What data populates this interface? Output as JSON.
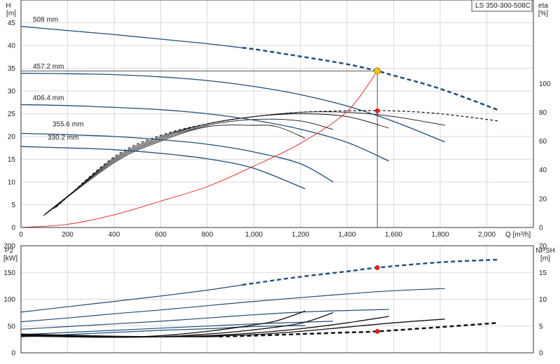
{
  "model": "LS 350-300-508C",
  "colors": {
    "blue": "#1f4e79",
    "red": "#e02020",
    "black": "#111111",
    "grid": "#d9d9d9",
    "op_point": "#f5c518"
  },
  "chart_data": [
    {
      "type": "line",
      "panel": "head_efficiency",
      "y_left_label": [
        "H",
        "[m]"
      ],
      "y_right_label": [
        "eta",
        "[%]"
      ],
      "x_label": "Q [m³/h]",
      "xlim": [
        0,
        2200
      ],
      "ylim": [
        0,
        50
      ],
      "y_right_lim": [
        0,
        158
      ],
      "x_ticks": [
        0,
        200,
        400,
        600,
        800,
        1000,
        1200,
        1400,
        1600,
        1800,
        2000
      ],
      "x_tick_labels": [
        "0",
        "200",
        "400",
        "600",
        "800",
        "1,000",
        "1,200",
        "1,400",
        "1,600",
        "1,800",
        "2,000"
      ],
      "y_ticks": [
        0,
        5,
        10,
        15,
        20,
        25,
        30,
        35,
        40,
        45
      ],
      "y_right_ticks": [
        0,
        20,
        40,
        60,
        80,
        100
      ],
      "head_curves": [
        {
          "name": "508 mm",
          "points": [
            [
              0,
              44.2
            ],
            [
              200,
              43.3
            ],
            [
              400,
              42.4
            ],
            [
              600,
              41.4
            ],
            [
              800,
              40.4
            ],
            [
              1000,
              39.2
            ],
            [
              1200,
              37.6
            ],
            [
              1400,
              35.9
            ],
            [
              1530,
              34.4
            ],
            [
              1600,
              33.4
            ],
            [
              1800,
              30.5
            ],
            [
              2050,
              25.8
            ]
          ],
          "dashed_from": 950
        },
        {
          "name": "457.2 mm",
          "points": [
            [
              0,
              33.9
            ],
            [
              200,
              33.8
            ],
            [
              400,
              33.6
            ],
            [
              600,
              33.1
            ],
            [
              800,
              32.3
            ],
            [
              1000,
              31.0
            ],
            [
              1200,
              29.2
            ],
            [
              1400,
              26.7
            ],
            [
              1600,
              23.3
            ],
            [
              1820,
              18.8
            ]
          ]
        },
        {
          "name": "406.4 mm",
          "points": [
            [
              0,
              27.0
            ],
            [
              200,
              26.8
            ],
            [
              400,
              26.4
            ],
            [
              600,
              25.9
            ],
            [
              800,
              25.0
            ],
            [
              1000,
              23.6
            ],
            [
              1200,
              21.6
            ],
            [
              1400,
              18.7
            ],
            [
              1580,
              14.6
            ]
          ]
        },
        {
          "name": "355.6 mm",
          "points": [
            [
              0,
              20.7
            ],
            [
              200,
              20.4
            ],
            [
              400,
              20.0
            ],
            [
              600,
              19.3
            ],
            [
              800,
              18.3
            ],
            [
              1000,
              16.6
            ],
            [
              1200,
              14.0
            ],
            [
              1340,
              10.0
            ]
          ]
        },
        {
          "name": "330.2 mm",
          "points": [
            [
              0,
              17.8
            ],
            [
              200,
              17.5
            ],
            [
              400,
              17.1
            ],
            [
              600,
              16.3
            ],
            [
              800,
              15.1
            ],
            [
              1000,
              13.0
            ],
            [
              1220,
              8.5
            ]
          ]
        }
      ],
      "system_curve": [
        [
          0,
          0
        ],
        [
          200,
          0.7
        ],
        [
          400,
          2.8
        ],
        [
          600,
          5.8
        ],
        [
          800,
          9.0
        ],
        [
          1000,
          13.5
        ],
        [
          1200,
          18.5
        ],
        [
          1400,
          25.5
        ],
        [
          1530,
          34.4
        ]
      ],
      "operating_point": {
        "q": 1530,
        "h": 34.4
      },
      "efficiency_curves": [
        {
          "name": "508 mm",
          "points": [
            [
              150,
              14
            ],
            [
              400,
              49
            ],
            [
              600,
              64
            ],
            [
              800,
              72
            ],
            [
              1000,
              77
            ],
            [
              1200,
              80
            ],
            [
              1400,
              81
            ],
            [
              1600,
              81
            ],
            [
              1800,
              79
            ],
            [
              2050,
              74
            ]
          ],
          "dashed": true
        },
        {
          "name": "457.2 mm",
          "points": [
            [
              140,
              13
            ],
            [
              400,
              48
            ],
            [
              600,
              63
            ],
            [
              800,
              72
            ],
            [
              1000,
              77
            ],
            [
              1200,
              80
            ],
            [
              1400,
              80
            ],
            [
              1600,
              77
            ],
            [
              1820,
              71
            ]
          ]
        },
        {
          "name": "406.4 mm",
          "points": [
            [
              120,
              11
            ],
            [
              400,
              47
            ],
            [
              600,
              62
            ],
            [
              800,
              72
            ],
            [
              1000,
              77
            ],
            [
              1200,
              79
            ],
            [
              1400,
              77
            ],
            [
              1580,
              69
            ]
          ]
        },
        {
          "name": "355.6 mm",
          "points": [
            [
              100,
              9
            ],
            [
              400,
              46
            ],
            [
              600,
              61
            ],
            [
              800,
              71
            ],
            [
              1000,
              75
            ],
            [
              1200,
              74
            ],
            [
              1340,
              68
            ]
          ]
        },
        {
          "name": "330.2 mm",
          "points": [
            [
              95,
              8
            ],
            [
              400,
              45
            ],
            [
              600,
              60
            ],
            [
              800,
              70
            ],
            [
              1000,
              71
            ],
            [
              1100,
              70
            ],
            [
              1220,
              62
            ]
          ]
        }
      ],
      "efficiency_point": {
        "q": 1530,
        "eta": 81
      }
    },
    {
      "type": "line",
      "panel": "power_npsh",
      "y_left_label": [
        "P2",
        "[kW]"
      ],
      "y_right_label": [
        "NPSH",
        "[m]"
      ],
      "xlim": [
        0,
        2200
      ],
      "ylim": [
        0,
        200
      ],
      "y_right_lim": [
        0,
        20
      ],
      "y_ticks": [
        0,
        50,
        100,
        150,
        200
      ],
      "y_right_ticks": [
        0,
        5,
        10,
        15,
        20
      ],
      "power_curves": [
        {
          "name": "508 mm",
          "points": [
            [
              0,
              76
            ],
            [
              200,
              86
            ],
            [
              400,
              96
            ],
            [
              600,
              106
            ],
            [
              800,
              117
            ],
            [
              1000,
              130
            ],
            [
              1200,
              142
            ],
            [
              1400,
              152
            ],
            [
              1530,
              159
            ],
            [
              1800,
              169
            ],
            [
              2050,
              174
            ]
          ],
          "dashed_from": 950
        },
        {
          "name": "457.2 mm",
          "points": [
            [
              0,
              58
            ],
            [
              200,
              65
            ],
            [
              400,
              73
            ],
            [
              600,
              80
            ],
            [
              800,
              88
            ],
            [
              1000,
              96
            ],
            [
              1200,
              103
            ],
            [
              1400,
              110
            ],
            [
              1600,
              116
            ],
            [
              1820,
              120
            ]
          ]
        },
        {
          "name": "406.4 mm",
          "points": [
            [
              0,
              44
            ],
            [
              200,
              49
            ],
            [
              400,
              54
            ],
            [
              600,
              59
            ],
            [
              800,
              65
            ],
            [
              1000,
              71
            ],
            [
              1200,
              76
            ],
            [
              1400,
              79
            ],
            [
              1580,
              81
            ]
          ]
        },
        {
          "name": "355.6 mm",
          "points": [
            [
              0,
              34
            ],
            [
              200,
              38
            ],
            [
              400,
              42
            ],
            [
              600,
              46
            ],
            [
              800,
              50
            ],
            [
              1000,
              54
            ],
            [
              1200,
              57
            ],
            [
              1340,
              59
            ]
          ]
        },
        {
          "name": "330.2 mm",
          "points": [
            [
              0,
              30
            ],
            [
              200,
              34
            ],
            [
              400,
              38
            ],
            [
              600,
              42
            ],
            [
              800,
              45
            ],
            [
              1000,
              49
            ],
            [
              1220,
              51
            ]
          ]
        }
      ],
      "power_point": {
        "q": 1530,
        "p": 159
      },
      "npsh_curves": [
        {
          "name": "508 mm",
          "points": [
            [
              0,
              3.5
            ],
            [
              200,
              3.3
            ],
            [
              400,
              3.1
            ],
            [
              600,
              3.0
            ],
            [
              800,
              3.0
            ],
            [
              1000,
              3.2
            ],
            [
              1200,
              3.5
            ],
            [
              1400,
              3.8
            ],
            [
              1530,
              4.0
            ],
            [
              1800,
              4.8
            ],
            [
              2050,
              5.6
            ]
          ],
          "dashed_from": 850
        },
        {
          "name": "457.2 mm",
          "points": [
            [
              0,
              3.4
            ],
            [
              200,
              3.2
            ],
            [
              400,
              3.0
            ],
            [
              600,
              3.0
            ],
            [
              800,
              3.1
            ],
            [
              1000,
              3.4
            ],
            [
              1200,
              4.0
            ],
            [
              1400,
              4.8
            ],
            [
              1600,
              5.6
            ],
            [
              1820,
              6.3
            ]
          ]
        },
        {
          "name": "406.4 mm",
          "points": [
            [
              0,
              3.3
            ],
            [
              200,
              3.1
            ],
            [
              400,
              3.0
            ],
            [
              600,
              3.0
            ],
            [
              800,
              3.2
            ],
            [
              1000,
              3.7
            ],
            [
              1200,
              4.5
            ],
            [
              1400,
              5.6
            ],
            [
              1580,
              6.8
            ]
          ]
        },
        {
          "name": "355.6 mm",
          "points": [
            [
              0,
              3.2
            ],
            [
              200,
              3.0
            ],
            [
              400,
              2.9
            ],
            [
              600,
              3.0
            ],
            [
              800,
              3.5
            ],
            [
              1000,
              4.3
            ],
            [
              1200,
              5.5
            ],
            [
              1340,
              7.5
            ]
          ]
        },
        {
          "name": "330.2 mm",
          "points": [
            [
              0,
              3.1
            ],
            [
              200,
              3.0
            ],
            [
              400,
              2.9
            ],
            [
              600,
              3.2
            ],
            [
              800,
              4.0
            ],
            [
              1000,
              5.2
            ],
            [
              1100,
              6.0
            ],
            [
              1220,
              7.8
            ]
          ]
        }
      ],
      "npsh_point": {
        "q": 1530,
        "npsh": 4.0
      }
    }
  ]
}
